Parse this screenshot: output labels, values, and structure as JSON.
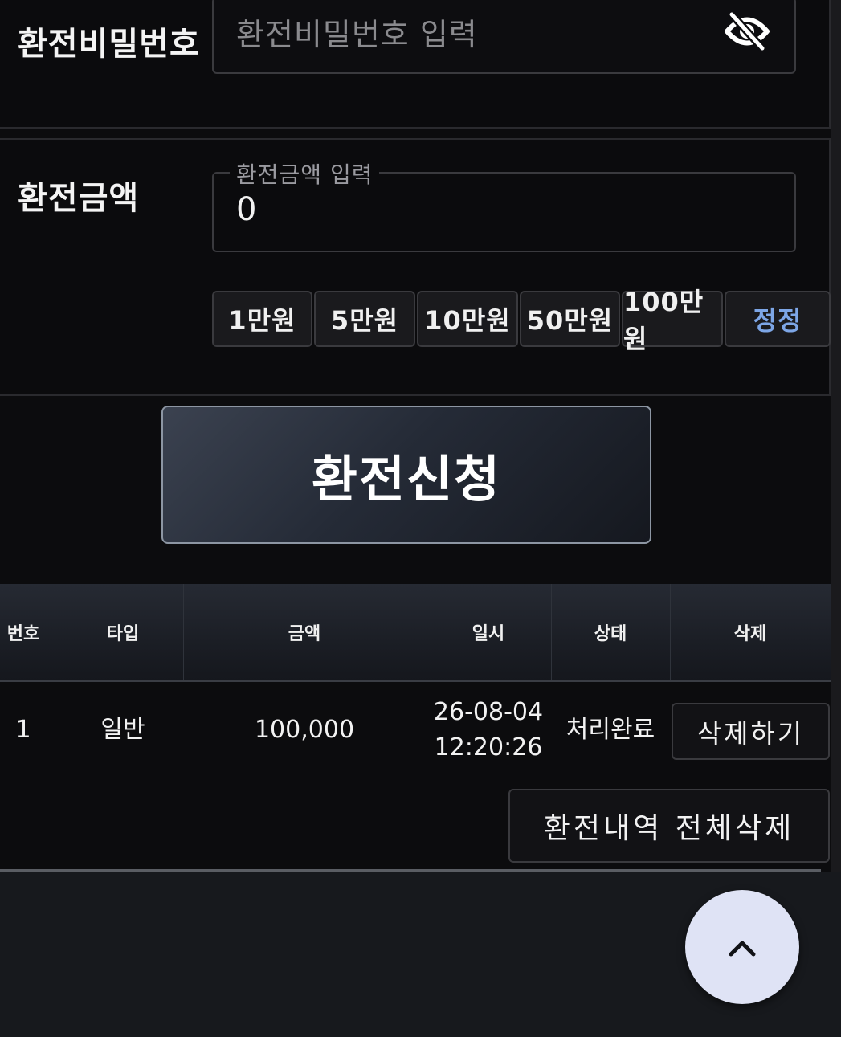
{
  "password": {
    "label": "환전비밀번호",
    "placeholder": "환전비밀번호 입력"
  },
  "amount": {
    "label": "환전금액",
    "legend": "환전금액 입력",
    "value": "0",
    "chips": [
      "1만원",
      "5만원",
      "10만원",
      "50만원",
      "100만원"
    ],
    "reset_label": "정정"
  },
  "submit_label": "환전신청",
  "table": {
    "headers": [
      "번호",
      "타입",
      "금액",
      "일시",
      "상태",
      "삭제"
    ],
    "rows": [
      {
        "no": "1",
        "type": "일반",
        "amount": "100,000",
        "date": "26-08-04",
        "time": "12:20:26",
        "status": "처리완료",
        "delete_label": "삭제하기"
      }
    ]
  },
  "delete_all_label": "환전내역 전체삭제",
  "icons": {
    "password_toggle": "eye-off-icon",
    "scroll_top": "chevron-up-icon"
  },
  "colors": {
    "accent_reset": "#7da6e6",
    "scroll_button": "#dfe3f5"
  }
}
